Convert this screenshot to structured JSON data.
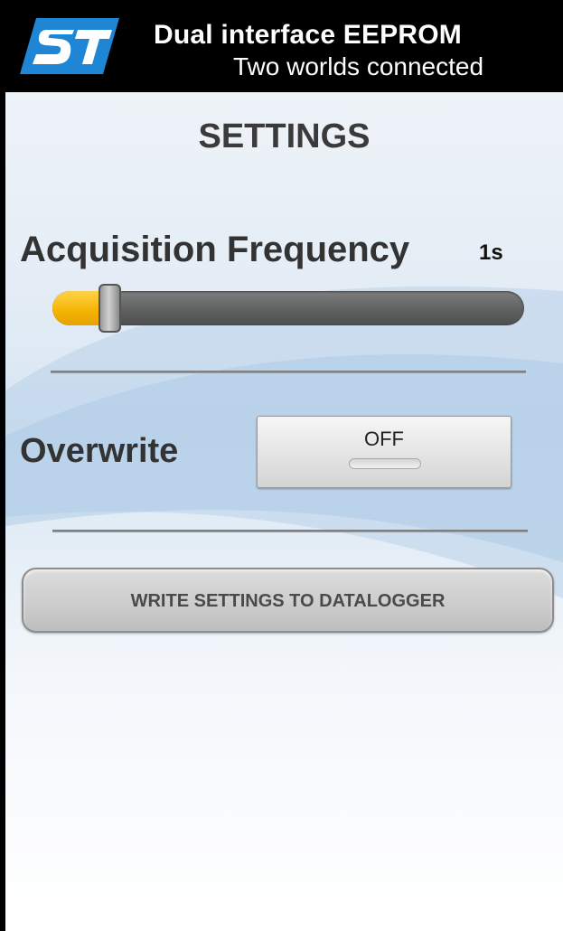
{
  "header": {
    "logo_text": "ST",
    "title": "Dual interface EEPROM",
    "subtitle": "Two worlds connected"
  },
  "settings": {
    "title": "SETTINGS",
    "acquisition": {
      "label": "Acquisition Frequency",
      "value": "1s",
      "slider_level": 0.12
    },
    "overwrite": {
      "label": "Overwrite",
      "toggle_label": "OFF",
      "state": false
    },
    "write_button_label": "WRITE SETTINGS TO DATALOGGER"
  },
  "colors": {
    "header_bg": "#000000",
    "logo_blue": "#1f86d6",
    "slider_fill": "#f5b300",
    "slider_track": "#5f6161"
  }
}
